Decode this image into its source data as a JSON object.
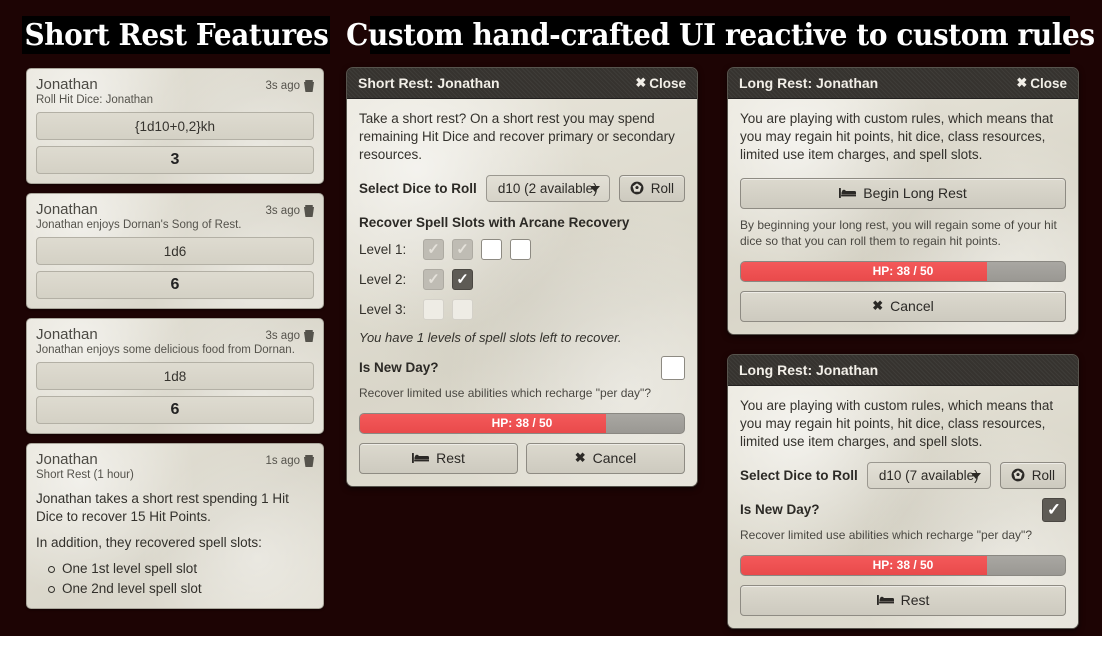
{
  "headings": {
    "left": "Short Rest Features",
    "right": "Custom hand-crafted UI reactive to custom rules"
  },
  "colors": {
    "background": "#1d0404",
    "panel": "#dedbd0",
    "titlebar": "#36332f",
    "hp_red": "#ef4a4a",
    "hp_track": "#a09e99"
  },
  "feature_cards": [
    {
      "author": "Jonathan",
      "time": "3s ago",
      "subtitle": "Roll Hit Dice: Jonathan",
      "formula": "{1d10+0,2}kh",
      "result": "3"
    },
    {
      "author": "Jonathan",
      "time": "3s ago",
      "subtitle": "Jonathan enjoys Dornan's Song of Rest.",
      "formula": "1d6",
      "result": "6"
    },
    {
      "author": "Jonathan",
      "time": "3s ago",
      "subtitle": "Jonathan enjoys some delicious food from Dornan.",
      "formula": "1d8",
      "result": "6"
    }
  ],
  "summary_card": {
    "author": "Jonathan",
    "time": "1s ago",
    "subtitle": "Short Rest (1 hour)",
    "paragraph1": "Jonathan takes a short rest spending 1 Hit Dice to recover 15 Hit Points.",
    "paragraph2": "In addition, they recovered spell slots:",
    "bullets": [
      "One 1st level spell slot",
      "One 2nd level spell slot"
    ]
  },
  "short_rest_dialog": {
    "title": "Short Rest: Jonathan",
    "close_label": "Close",
    "intro": "Take a short rest? On a short rest you may spend remaining Hit Dice and recover primary or secondary resources.",
    "dice_label": "Select Dice to Roll",
    "dice_value": "d10 (2 available)",
    "roll_label": "Roll",
    "spell_heading": "Recover Spell Slots with Arcane Recovery",
    "slot_rows": [
      {
        "label": "Level 1:",
        "states": [
          "used",
          "used",
          "empty",
          "empty"
        ]
      },
      {
        "label": "Level 2:",
        "states": [
          "used",
          "picked"
        ]
      },
      {
        "label": "Level 3:",
        "states": [
          "off",
          "off"
        ]
      }
    ],
    "slots_note": "You have 1 levels of spell slots left to recover.",
    "new_day_label": "Is New Day?",
    "new_day_checked": false,
    "new_day_note": "Recover limited use abilities which recharge \"per day\"?",
    "hp_text": "HP: 38 / 50",
    "hp_current": 38,
    "hp_max": 50,
    "rest_label": "Rest",
    "cancel_label": "Cancel"
  },
  "long_rest_begin_dialog": {
    "title": "Long Rest: Jonathan",
    "close_label": "Close",
    "intro": "You are playing with custom rules, which means that you may regain hit points, hit dice, class resources, limited use item charges, and spell slots.",
    "begin_label": "Begin Long Rest",
    "note": "By beginning your long rest, you will regain some of your hit dice so that you can roll them to regain hit points.",
    "hp_text": "HP: 38 / 50",
    "hp_current": 38,
    "hp_max": 50,
    "cancel_label": "Cancel"
  },
  "long_rest_roll_dialog": {
    "title": "Long Rest: Jonathan",
    "intro": "You are playing with custom rules, which means that you may regain hit points, hit dice, class resources, limited use item charges, and spell slots.",
    "dice_label": "Select Dice to Roll",
    "dice_value": "d10 (7 available)",
    "roll_label": "Roll",
    "new_day_label": "Is New Day?",
    "new_day_checked": true,
    "new_day_note": "Recover limited use abilities which recharge \"per day\"?",
    "hp_text": "HP: 38 / 50",
    "hp_current": 38,
    "hp_max": 50,
    "rest_label": "Rest"
  }
}
